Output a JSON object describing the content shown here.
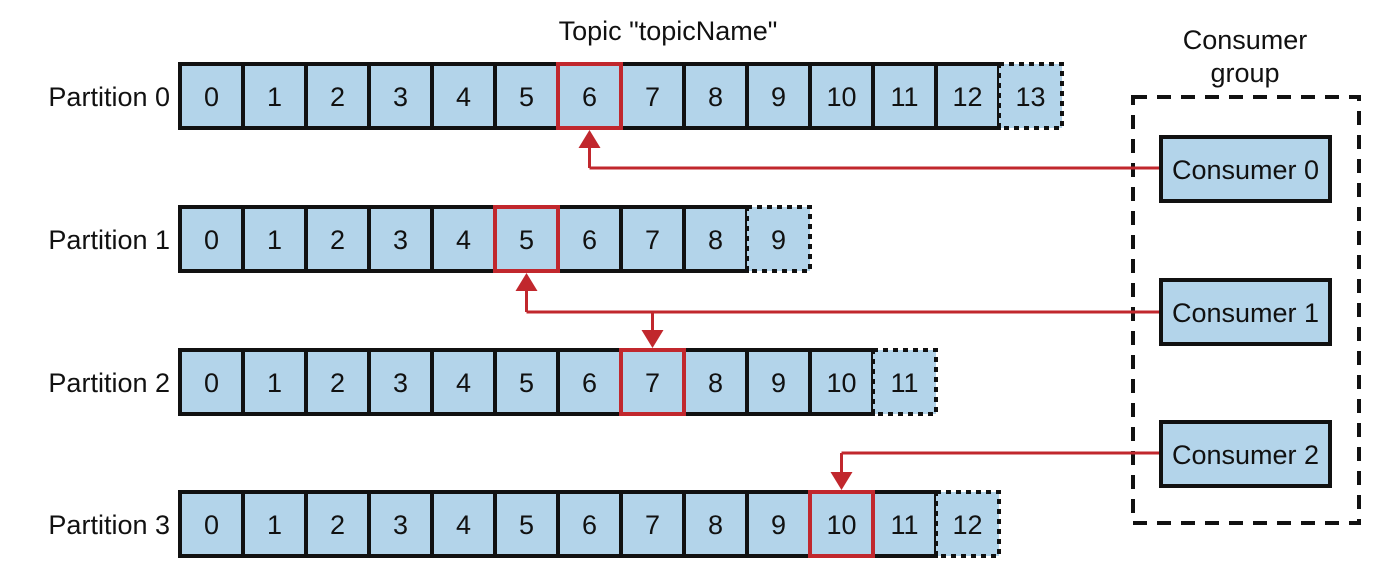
{
  "title": "Topic \"topicName\"",
  "group": {
    "label_line1": "Consumer",
    "label_line2": "group"
  },
  "colors": {
    "cell_fill": "#b3d4ea",
    "border": "#111111",
    "highlight": "#c1272d"
  },
  "partitions": [
    {
      "label": "Partition 0",
      "offsets": [
        "0",
        "1",
        "2",
        "3",
        "4",
        "5",
        "6",
        "7",
        "8",
        "9",
        "10",
        "11",
        "12"
      ],
      "next": "13",
      "current": 6
    },
    {
      "label": "Partition 1",
      "offsets": [
        "0",
        "1",
        "2",
        "3",
        "4",
        "5",
        "6",
        "7",
        "8"
      ],
      "next": "9",
      "current": 5
    },
    {
      "label": "Partition 2",
      "offsets": [
        "0",
        "1",
        "2",
        "3",
        "4",
        "5",
        "6",
        "7",
        "8",
        "9",
        "10"
      ],
      "next": "11",
      "current": 7
    },
    {
      "label": "Partition 3",
      "offsets": [
        "0",
        "1",
        "2",
        "3",
        "4",
        "5",
        "6",
        "7",
        "8",
        "9",
        "10",
        "11"
      ],
      "next": "12",
      "current": 10
    }
  ],
  "consumers": [
    {
      "label": "Consumer 0",
      "reads": [
        0
      ]
    },
    {
      "label": "Consumer 1",
      "reads": [
        1,
        2
      ]
    },
    {
      "label": "Consumer 2",
      "reads": [
        3
      ]
    }
  ]
}
